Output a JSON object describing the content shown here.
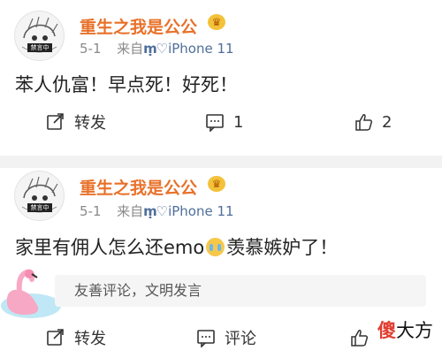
{
  "posts": [
    {
      "username": "重生之我是公公",
      "date": "5-1",
      "via": "来自",
      "device": "iPhone 11",
      "avatar_tag": "禁言中",
      "content": "苯人仇富！早点死！好死！",
      "actions": {
        "repost": "转发",
        "comment_count": "1",
        "like_count": "2"
      }
    },
    {
      "username": "重生之我是公公",
      "date": "5-1",
      "via": "来自",
      "device": "iPhone 11",
      "avatar_tag": "禁言中",
      "content_before": "家里有佣人怎么还emo",
      "content_after": "羡慕嫉妒了！",
      "comment_placeholder": "友善评论，文明发言",
      "actions": {
        "repost": "转发",
        "comment": "评论"
      }
    }
  ],
  "watermark": {
    "part1": "傻",
    "part2": "大方"
  },
  "colors": {
    "username": "#e8712a",
    "device": "#4f6f9a",
    "background_gap": "#f2f2f2"
  },
  "icons": [
    "share-icon",
    "comment-icon",
    "like-icon",
    "vip-crown-icon",
    "crying-emoji-icon",
    "flamingo-float-icon"
  ]
}
